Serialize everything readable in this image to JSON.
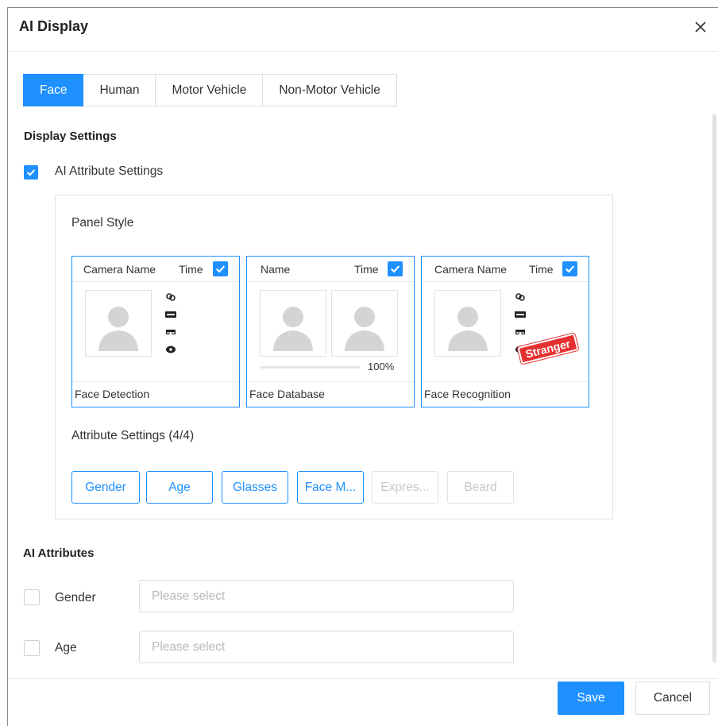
{
  "window": {
    "title": "AI Display"
  },
  "tabs": [
    {
      "label": "Face",
      "active": true
    },
    {
      "label": "Human",
      "active": false
    },
    {
      "label": "Motor Vehicle",
      "active": false
    },
    {
      "label": "Non-Motor Vehicle",
      "active": false
    }
  ],
  "display_settings": {
    "title": "Display Settings",
    "ai_attribute_settings": {
      "label": "AI Attribute Settings",
      "checked": true
    },
    "panel_style": {
      "label": "Panel Style",
      "cards": [
        {
          "name": "Camera Name",
          "time_label": "Time",
          "time_checked": true,
          "caption": "Face Detection",
          "icons": [
            "gender-icon",
            "age-icon",
            "glasses-icon",
            "mask-icon"
          ]
        },
        {
          "name": "Name",
          "time_label": "Time",
          "time_checked": true,
          "caption": "Face Database",
          "similarity": "100%"
        },
        {
          "name": "Camera Name",
          "time_label": "Time",
          "time_checked": true,
          "caption": "Face Recognition",
          "icons": [
            "gender-icon",
            "age-icon",
            "glasses-icon",
            "mask-icon"
          ],
          "stamp": "Stranger"
        }
      ]
    },
    "attribute_settings": {
      "label": "Attribute Settings (4/4)",
      "buttons": [
        {
          "label": "Gender",
          "enabled": true
        },
        {
          "label": "Age",
          "enabled": true
        },
        {
          "label": "Glasses",
          "enabled": true
        },
        {
          "label": "Face M...",
          "enabled": true
        },
        {
          "label": "Expres...",
          "enabled": false
        },
        {
          "label": "Beard",
          "enabled": false
        }
      ]
    }
  },
  "ai_attributes": {
    "title": "AI Attributes",
    "rows": [
      {
        "label": "Gender",
        "checked": false,
        "placeholder": "Please select"
      },
      {
        "label": "Age",
        "checked": false,
        "placeholder": "Please select"
      }
    ]
  },
  "footer": {
    "save_label": "Save",
    "cancel_label": "Cancel"
  },
  "colors": {
    "accent": "#1e90ff",
    "stamp": "#e53030"
  }
}
